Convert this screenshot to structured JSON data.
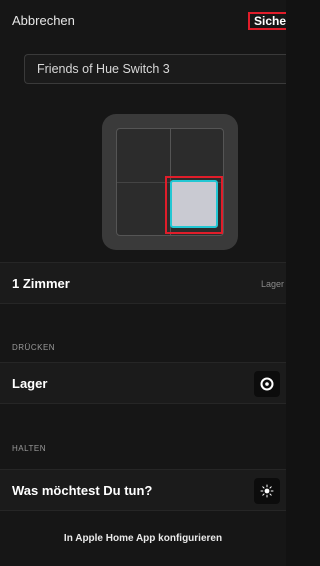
{
  "header": {
    "cancel_label": "Abbrechen",
    "save_label": "Sichern"
  },
  "name_field": {
    "value": "Friends of Hue Switch 3"
  },
  "rooms": {
    "label": "1 Zimmer",
    "value": "Lager"
  },
  "press_section": {
    "title": "DRÜCKEN",
    "label": "Lager",
    "icon": "room-icon"
  },
  "hold_section": {
    "title": "HALTEN",
    "label": "Was möchtest Du tun?",
    "icon": "sun-icon"
  },
  "footer": {
    "link_label": "In Apple Home App konfigurieren"
  },
  "colors": {
    "highlight": "#e11d2a",
    "button_outline": "#22c7d3",
    "background": "#161616"
  }
}
